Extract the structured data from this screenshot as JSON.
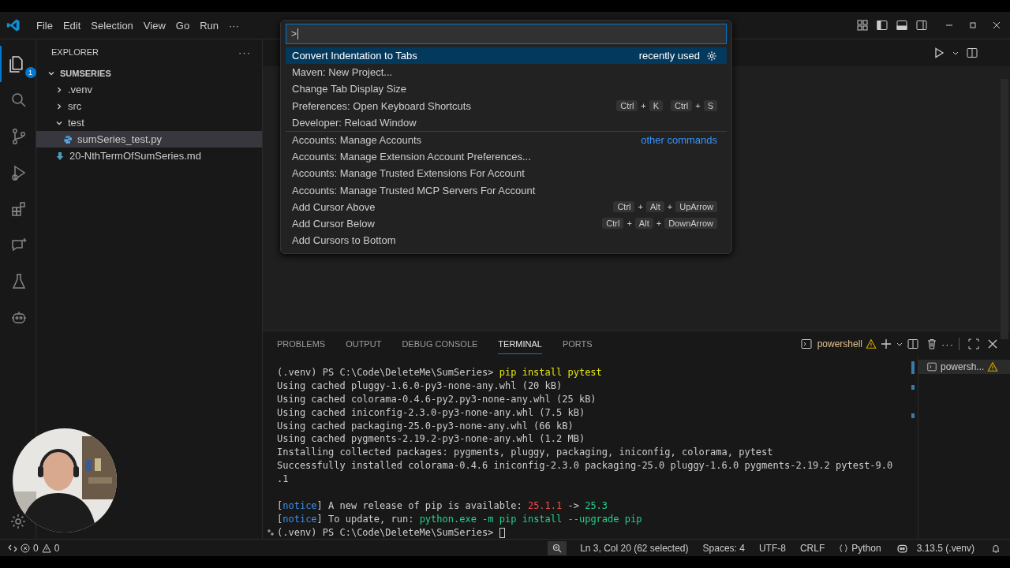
{
  "menu": [
    "File",
    "Edit",
    "Selection",
    "View",
    "Go",
    "Run",
    "···"
  ],
  "activity_bar": [
    {
      "kind": "files",
      "selected": true,
      "badge": "1"
    },
    {
      "kind": "search",
      "selected": false
    },
    {
      "kind": "source-control",
      "selected": false
    },
    {
      "kind": "run-debug",
      "selected": false
    },
    {
      "kind": "extensions",
      "selected": false
    },
    {
      "kind": "chat",
      "selected": false
    },
    {
      "kind": "flask",
      "selected": false
    },
    {
      "kind": "robot",
      "selected": false
    }
  ],
  "command_palette": {
    "value": ">",
    "items": [
      {
        "label": "Convert Indentation to Tabs",
        "selected": true,
        "hint": "recently used",
        "gear": true
      },
      {
        "label": "Maven: New Project...",
        "selected": false
      },
      {
        "label": "Change Tab Display Size",
        "selected": false
      },
      {
        "label": "Preferences: Open Keyboard Shortcuts",
        "selected": false,
        "keys": [
          [
            "Ctrl",
            "+",
            "K"
          ],
          [
            "Ctrl",
            "+",
            "S"
          ]
        ]
      },
      {
        "label": "Developer: Reload Window",
        "selected": false
      },
      {
        "label": "Accounts: Manage Accounts",
        "selected": false,
        "group": "other commands"
      },
      {
        "label": "Accounts: Manage Extension Account Preferences...",
        "selected": false
      },
      {
        "label": "Accounts: Manage Trusted Extensions For Account",
        "selected": false
      },
      {
        "label": "Accounts: Manage Trusted MCP Servers For Account",
        "selected": false
      },
      {
        "label": "Add Cursor Above",
        "selected": false,
        "keys": [
          [
            "Ctrl",
            "+",
            "Alt",
            "+",
            "UpArrow"
          ]
        ]
      },
      {
        "label": "Add Cursor Below",
        "selected": false,
        "keys": [
          [
            "Ctrl",
            "+",
            "Alt",
            "+",
            "DownArrow"
          ]
        ]
      },
      {
        "label": "Add Cursors to Bottom",
        "selected": false
      }
    ]
  },
  "explorer": {
    "title": "EXPLORER",
    "more": "···",
    "tree": [
      {
        "label": "SUMSERIES",
        "kind": "folder",
        "expanded": true,
        "selected": false,
        "children": [
          {
            "label": ".venv",
            "kind": "folder",
            "expanded": false,
            "selected": false
          },
          {
            "label": "src",
            "kind": "folder",
            "expanded": false,
            "selected": false
          },
          {
            "label": "test",
            "kind": "folder",
            "expanded": true,
            "selected": false,
            "children": [
              {
                "label": "sumSeries_test.py",
                "kind": "python",
                "selected": true
              }
            ]
          },
          {
            "label": "20-NthTermOfSumSeries.md",
            "kind": "markdown",
            "selected": false
          }
        ]
      }
    ]
  },
  "panel": {
    "tabs": [
      {
        "label": "PROBLEMS",
        "selected": false
      },
      {
        "label": "OUTPUT",
        "selected": false
      },
      {
        "label": "DEBUG CONSOLE",
        "selected": false
      },
      {
        "label": "TERMINAL",
        "selected": true
      },
      {
        "label": "PORTS",
        "selected": false
      }
    ],
    "shell": "powershell",
    "more": "···",
    "terminal_lines": [
      {
        "segments": [
          {
            "text": "(.venv) PS C:\\Code\\DeleteMe\\SumSeries> ",
            "kind": "plain"
          },
          {
            "text": "pip install pytest",
            "kind": "command"
          }
        ]
      },
      {
        "segments": [
          {
            "text": "Using cached pluggy-1.6.0-py3-none-any.whl (20 kB)",
            "kind": "plain"
          }
        ]
      },
      {
        "segments": [
          {
            "text": "Using cached colorama-0.4.6-py2.py3-none-any.whl (25 kB)",
            "kind": "plain"
          }
        ]
      },
      {
        "segments": [
          {
            "text": "Using cached iniconfig-2.3.0-py3-none-any.whl (7.5 kB)",
            "kind": "plain"
          }
        ]
      },
      {
        "segments": [
          {
            "text": "Using cached packaging-25.0-py3-none-any.whl (66 kB)",
            "kind": "plain"
          }
        ]
      },
      {
        "segments": [
          {
            "text": "Using cached pygments-2.19.2-py3-none-any.whl (1.2 MB)",
            "kind": "plain"
          }
        ]
      },
      {
        "segments": [
          {
            "text": "Installing collected packages: pygments, pluggy, packaging, iniconfig, colorama, pytest",
            "kind": "plain"
          }
        ]
      },
      {
        "segments": [
          {
            "text": "Successfully installed colorama-0.4.6 iniconfig-2.3.0 packaging-25.0 pluggy-1.6.0 pygments-2.19.2 pytest-9.0",
            "kind": "plain"
          }
        ]
      },
      {
        "segments": [
          {
            "text": ".1",
            "kind": "plain"
          }
        ]
      },
      {
        "gap_before": true,
        "segments": [
          {
            "text": "[",
            "kind": "plain"
          },
          {
            "text": "notice",
            "kind": "notice"
          },
          {
            "text": "] A new release of pip is available: ",
            "kind": "plain"
          },
          {
            "text": "25.1.1",
            "kind": "old"
          },
          {
            "text": " -> ",
            "kind": "plain"
          },
          {
            "text": "25.3",
            "kind": "new"
          }
        ]
      },
      {
        "segments": [
          {
            "text": "[",
            "kind": "plain"
          },
          {
            "text": "notice",
            "kind": "notice"
          },
          {
            "text": "] To update, run: ",
            "kind": "plain"
          },
          {
            "text": "python.exe -m pip install --upgrade pip",
            "kind": "new"
          }
        ]
      },
      {
        "marker": true,
        "cursor": true,
        "segments": [
          {
            "text": "(.venv) PS C:\\Code\\DeleteMe\\SumSeries> ",
            "kind": "plain"
          }
        ]
      }
    ],
    "terminals": [
      {
        "label": "powersh...",
        "selected": true
      }
    ]
  },
  "status_bar": {
    "errors": "0",
    "warnings": "0",
    "items": [
      "Ln 3, Col 20 (62 selected)",
      "Spaces: 4",
      "UTF-8",
      "CRLF"
    ],
    "language": "Python",
    "interpreter": "3.13.5 (.venv)"
  },
  "webcam": {
    "kind": "picture"
  }
}
